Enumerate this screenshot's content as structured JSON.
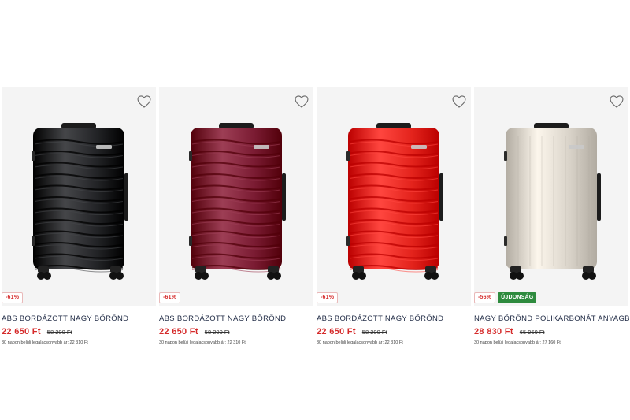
{
  "products": [
    {
      "title": "ABS BORDÁZOTT NAGY BŐRÖND",
      "price": "22 650 Ft",
      "old_price": "58 200 Ft",
      "discount": "-61%",
      "badge_new": "",
      "lowest_price_note": "30 napon belüli legalacsonyabb ár: 22 310 Ft",
      "color_name": "black",
      "color": "#222326"
    },
    {
      "title": "ABS BORDÁZOTT NAGY BŐRÖND",
      "price": "22 650 Ft",
      "old_price": "58 200 Ft",
      "discount": "-61%",
      "badge_new": "",
      "lowest_price_note": "30 napon belüli legalacsonyabb ár: 22 310 Ft",
      "color_name": "burgundy",
      "color": "#7a1b32"
    },
    {
      "title": "ABS BORDÁZOTT NAGY BŐRÖND",
      "price": "22 650 Ft",
      "old_price": "58 200 Ft",
      "discount": "-61%",
      "badge_new": "",
      "lowest_price_note": "30 napon belüli legalacsonyabb ár: 22 310 Ft",
      "color_name": "red",
      "color": "#e3231c"
    },
    {
      "title": "NAGY BŐRÖND POLIKARBONÁT ANYAGBÓL",
      "price": "28 830 Ft",
      "old_price": "65 960 Ft",
      "discount": "-56%",
      "badge_new": "ÚJDONSÁG",
      "lowest_price_note": "30 napon belüli legalacsonyabb ár: 27 160 Ft",
      "color_name": "champagne",
      "color": "#d9d3c9"
    }
  ],
  "icons": {
    "favorite": "heart-outline-icon"
  },
  "colors": {
    "price_red": "#d52a2a",
    "new_badge_green": "#2e8b3e",
    "title_navy": "#1f2a44",
    "image_bg": "#f4f4f4"
  }
}
